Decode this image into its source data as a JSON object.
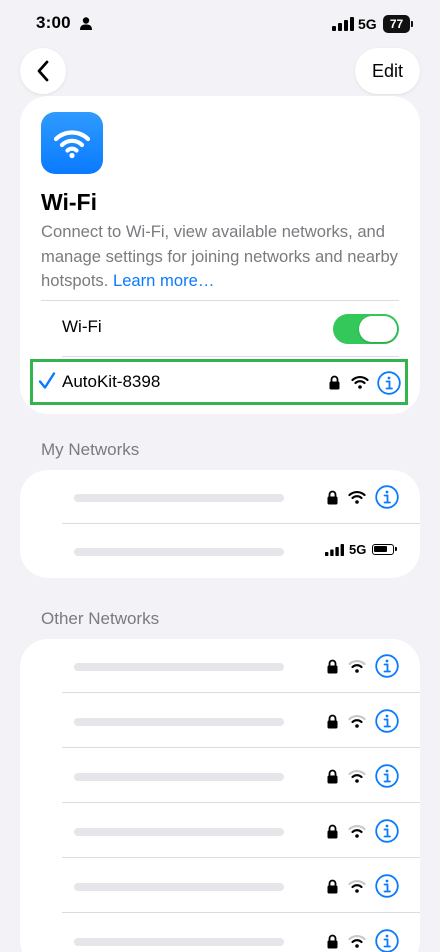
{
  "status_bar": {
    "time": "3:00",
    "network": "5G",
    "battery": "77"
  },
  "nav": {
    "edit_label": "Edit"
  },
  "wifi_card": {
    "title": "Wi-Fi",
    "description": "Connect to Wi-Fi, view available networks, and manage settings for joining networks and nearby hotspots.",
    "learn_more": "Learn more…",
    "toggle_label": "Wi-Fi",
    "toggle_on": true,
    "connected_network": "AutoKit-8398"
  },
  "my_networks": {
    "header": "My Networks",
    "rows": [
      {
        "type": "wifi",
        "locked": true
      },
      {
        "type": "hotspot",
        "network": "5G"
      }
    ]
  },
  "other_networks": {
    "header": "Other Networks",
    "rows": [
      {
        "type": "wifi",
        "locked": true
      },
      {
        "type": "wifi",
        "locked": true
      },
      {
        "type": "wifi",
        "locked": true
      },
      {
        "type": "wifi",
        "locked": true
      },
      {
        "type": "wifi",
        "locked": true
      },
      {
        "type": "wifi",
        "locked": true
      }
    ]
  },
  "colors": {
    "accent": "#0a7aff",
    "toggle_on": "#34c759",
    "highlight_border": "#34b34f",
    "background": "#f2f2f7"
  },
  "icons": {
    "back": "chevron-left-icon",
    "app": "wifi-icon",
    "check": "checkmark-icon",
    "lock": "lock-icon",
    "wifi": "wifi-signal-icon",
    "info": "info-icon"
  }
}
